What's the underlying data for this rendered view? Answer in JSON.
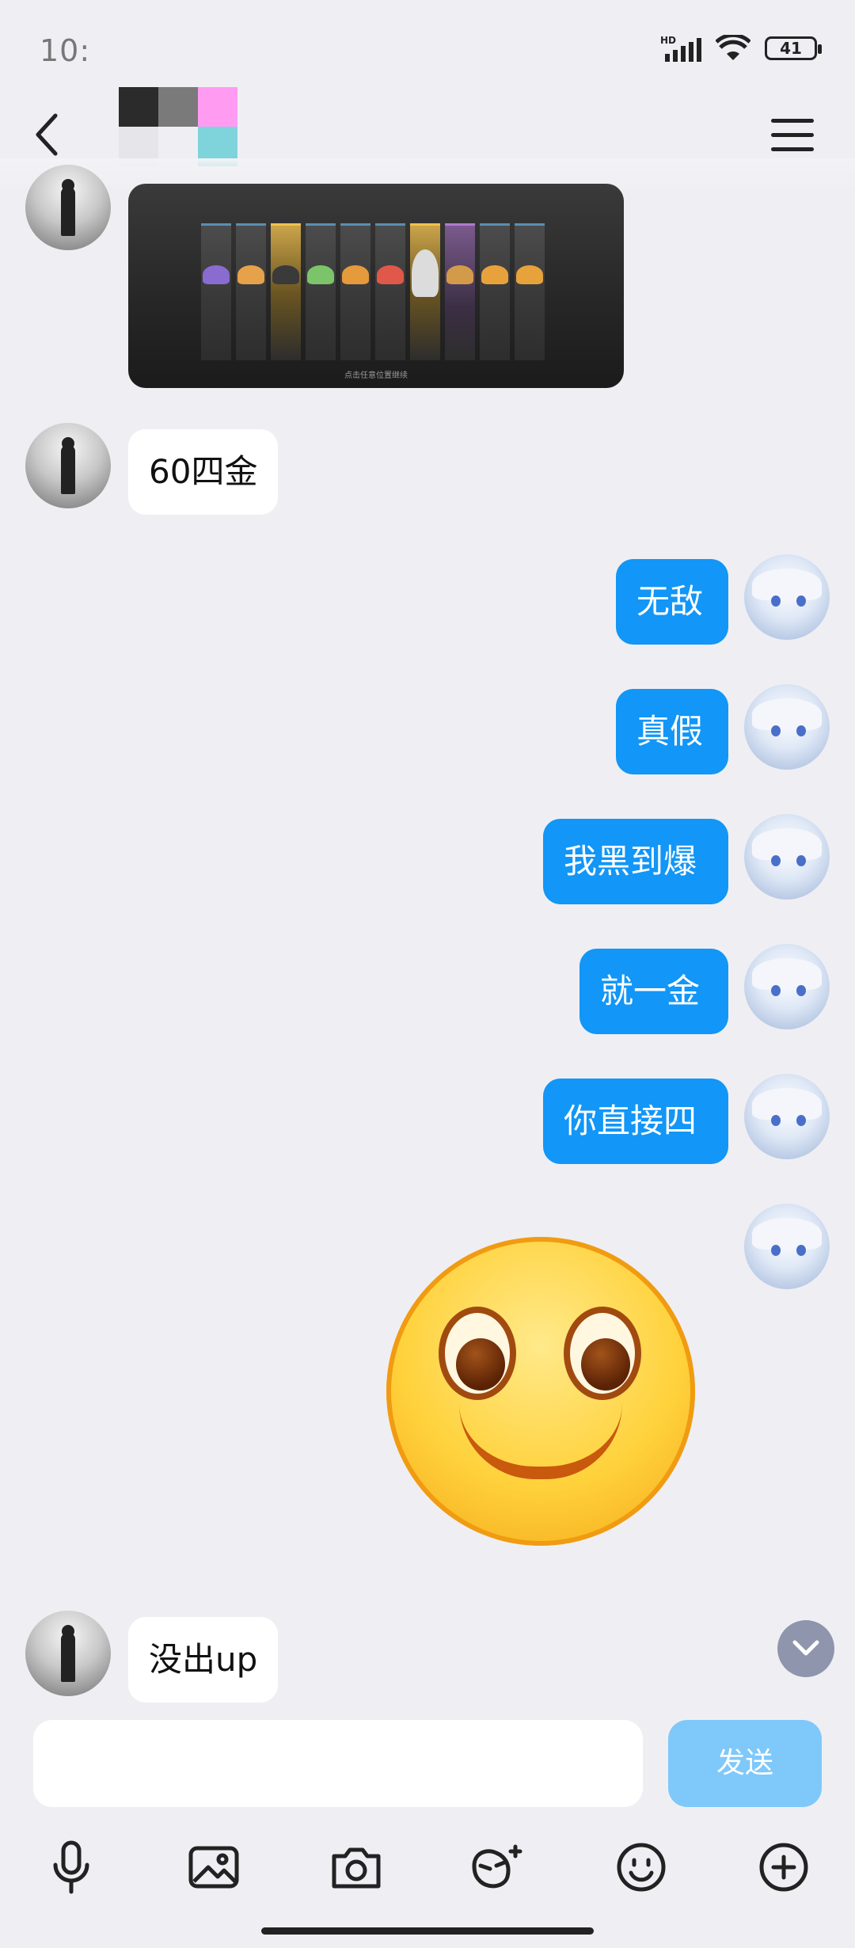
{
  "status_bar": {
    "time": "10:",
    "hd_label": "HD",
    "battery": "41"
  },
  "header": {
    "title": ""
  },
  "messages": [
    {
      "side": "left",
      "type": "image",
      "image_caption": "点击任意位置继续"
    },
    {
      "side": "left",
      "type": "text",
      "text": "60四金"
    },
    {
      "side": "right",
      "type": "text",
      "text": "无敌"
    },
    {
      "side": "right",
      "type": "text",
      "text": "真假"
    },
    {
      "side": "right",
      "type": "text",
      "text": "我黑到爆"
    },
    {
      "side": "right",
      "type": "text",
      "text": "就一金"
    },
    {
      "side": "right",
      "type": "text",
      "text": "你直接四"
    },
    {
      "side": "right",
      "type": "emoji",
      "emoji": "smile-emoji"
    },
    {
      "side": "left",
      "type": "text",
      "text": "没出up"
    }
  ],
  "input": {
    "value": "",
    "placeholder": ""
  },
  "send_button": {
    "label": "发送"
  },
  "toolbar": [
    "microphone-icon",
    "image-icon",
    "camera-icon",
    "red-packet-icon",
    "emoji-icon",
    "plus-icon"
  ],
  "colors": {
    "accent": "#1296f7",
    "send_disabled": "#7fc8fa",
    "background": "#efeff3"
  }
}
